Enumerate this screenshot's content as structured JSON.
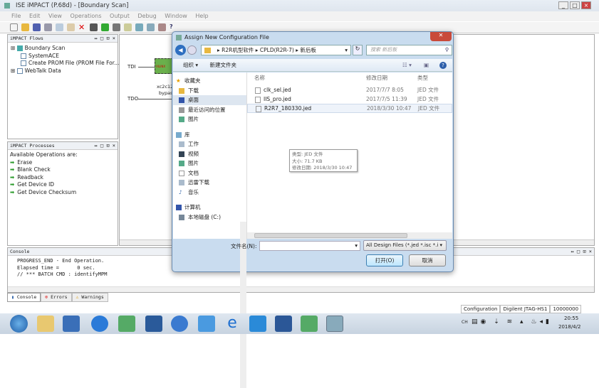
{
  "app": {
    "title": "ISE iMPACT (P.68d) - [Boundary Scan]",
    "menu": [
      "File",
      "Edit",
      "View",
      "Operations",
      "Output",
      "Debug",
      "Window",
      "Help"
    ]
  },
  "flows": {
    "title": "iMPACT Flows",
    "controls": "↔ □ ⊡ ×",
    "items": [
      "Boundary Scan",
      "SystemACE",
      "Create PROM File (PROM File For...",
      "WebTalk Data"
    ]
  },
  "processes": {
    "title": "iMPACT Processes",
    "controls": "↔ □ ⊡ ×",
    "header": "Available Operations are:",
    "items": [
      "Erase",
      "Blank Check",
      "Readback",
      "Get Device ID",
      "Get Device Checksum"
    ]
  },
  "canvas": {
    "tdi": "TDI",
    "tdo": "TDO",
    "chip_logo": "XILINX",
    "device": "xc2c12",
    "device_status": "bypass"
  },
  "dialog": {
    "title": "Assign New Configuration File",
    "path": [
      "R2R机型软件",
      "CPLD(R2R-7)",
      "新后板"
    ],
    "search_placeholder": "搜索 新后板",
    "organize": "组织 ▾",
    "new_folder": "新建文件夹",
    "nav": {
      "favorites": "收藏夹",
      "fav_items": [
        "下载",
        "桌面",
        "最近访问的位置",
        "图片"
      ],
      "library": "库",
      "lib_items": [
        "工作",
        "视频",
        "图片",
        "文档",
        "迅雷下载",
        "音乐"
      ],
      "computer": "计算机",
      "comp_items": [
        "本地磁盘 (C:)"
      ]
    },
    "columns": {
      "name": "名称",
      "date": "修改日期",
      "type": "类型"
    },
    "files": [
      {
        "name": "clk_sel.jed",
        "date": "2017/7/7 8:05",
        "type": "JED 文件"
      },
      {
        "name": "IIS_pro.jed",
        "date": "2017/7/5 11:39",
        "type": "JED 文件"
      },
      {
        "name": "R2R7_180330.jed",
        "date": "2018/3/30 10:47",
        "type": "JED 文件"
      }
    ],
    "tooltip": [
      "类型: JED 文件",
      "大小: 71.7 KB",
      "修改日期: 2018/3/30 10:47"
    ],
    "filename_label": "文件名(N):",
    "filename_value": "",
    "filter": "All Design Files (*.jed *.isc *.i ▾",
    "open": "打开(O)",
    "cancel": "取消"
  },
  "console": {
    "title": "Console",
    "lines": [
      "PROGRESS_END - End Operation.",
      "Elapsed time =      0 sec.",
      "// *** BATCH CMD : identifyMPM"
    ],
    "tabs": [
      "Console",
      "Errors",
      "Warnings"
    ]
  },
  "status": {
    "mode": "Configuration",
    "cable": "Digilent JTAG-HS1",
    "speed": "10000000"
  },
  "taskbar": {
    "lang": "CH",
    "time": "20:55",
    "date": "2018/4/2"
  }
}
